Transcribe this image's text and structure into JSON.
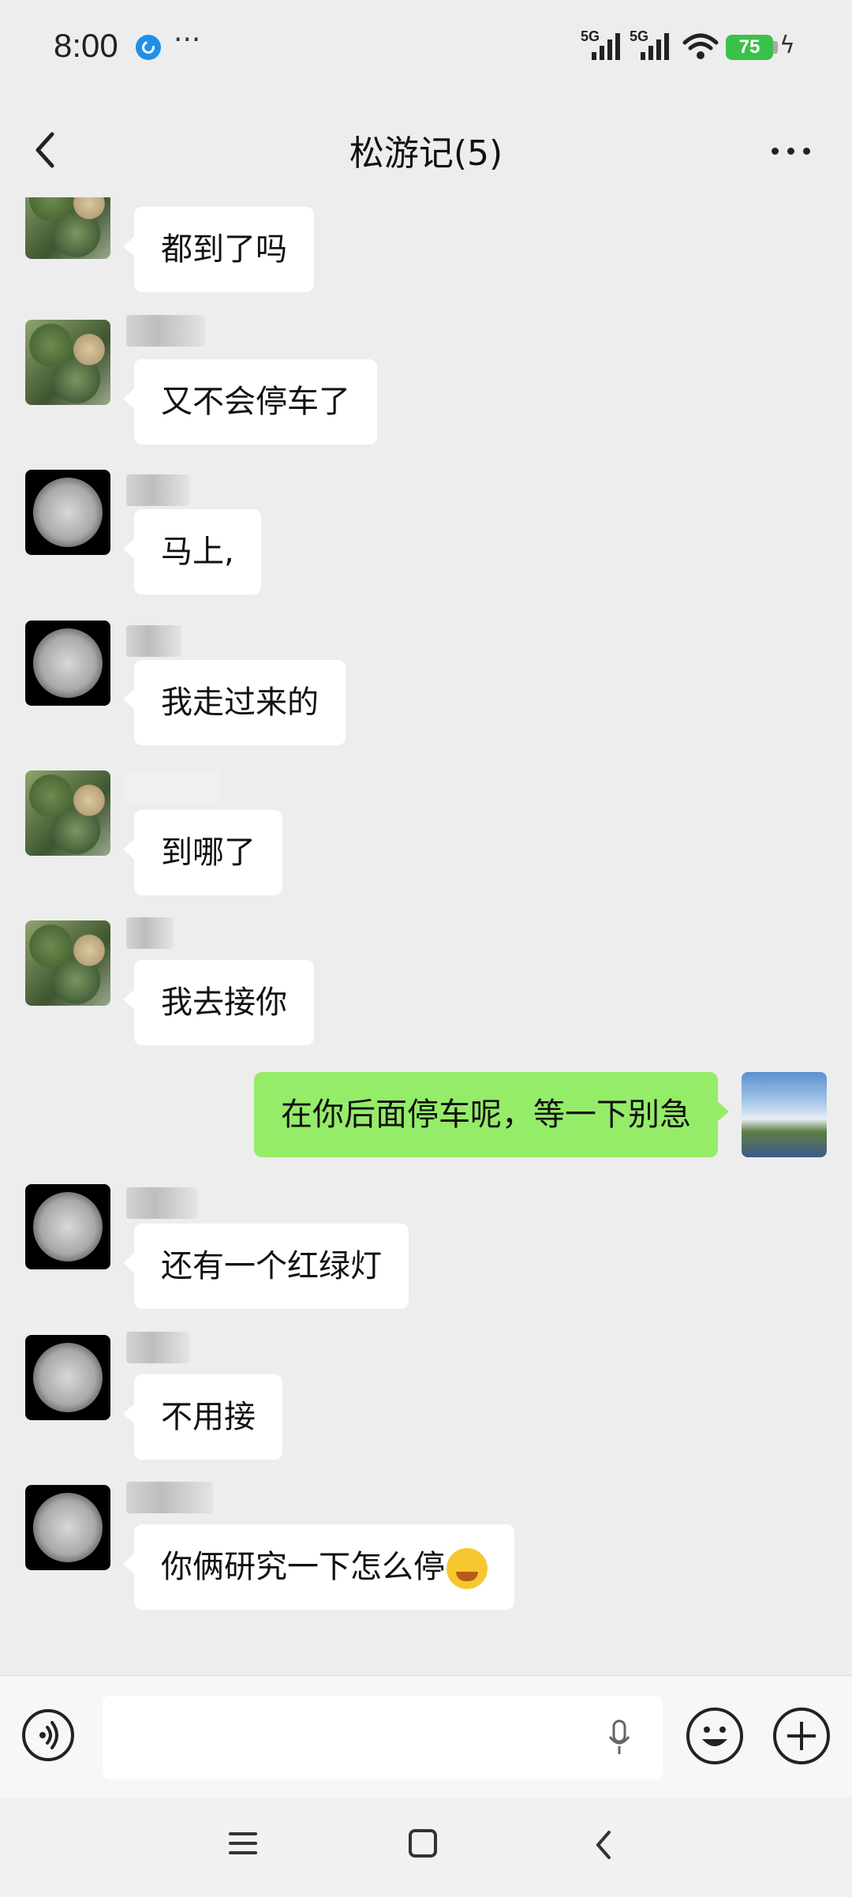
{
  "status": {
    "time": "8:00",
    "more": "···",
    "signal1": "5G",
    "signal2": "5G",
    "battery": "75"
  },
  "header": {
    "title": "松游记(5)"
  },
  "messages": [
    {
      "text": "都到了吗",
      "avatar": "tree"
    },
    {
      "text": "又不会停车了",
      "avatar": "tree"
    },
    {
      "text": "马上,",
      "avatar": "bird"
    },
    {
      "text": "我走过来的",
      "avatar": "bird"
    },
    {
      "text": "到哪了",
      "avatar": "tree"
    },
    {
      "text": "我去接你",
      "avatar": "tree"
    },
    {
      "text": "在你后面停车呢，等一下别急",
      "avatar": "me",
      "mine": true
    },
    {
      "text": "还有一个红绿灯",
      "avatar": "bird"
    },
    {
      "text": "不用接",
      "avatar": "bird"
    },
    {
      "text": "你俩研究一下怎么停",
      "avatar": "bird",
      "emoji": "crying-laughing-emoji"
    }
  ],
  "input": {
    "value": ""
  },
  "icons": {
    "back": "back-chevron-icon",
    "menu": "more-icon",
    "voice": "voice-icon",
    "mic": "microphone-icon",
    "emoji": "emoji-icon",
    "plus": "plus-icon",
    "wifi": "wifi-icon",
    "battery": "battery-icon",
    "charging": "charging-icon"
  },
  "colors": {
    "background": "#ededed",
    "bubble_other": "#ffffff",
    "bubble_mine": "#95ec69",
    "battery": "#3ac14a"
  }
}
